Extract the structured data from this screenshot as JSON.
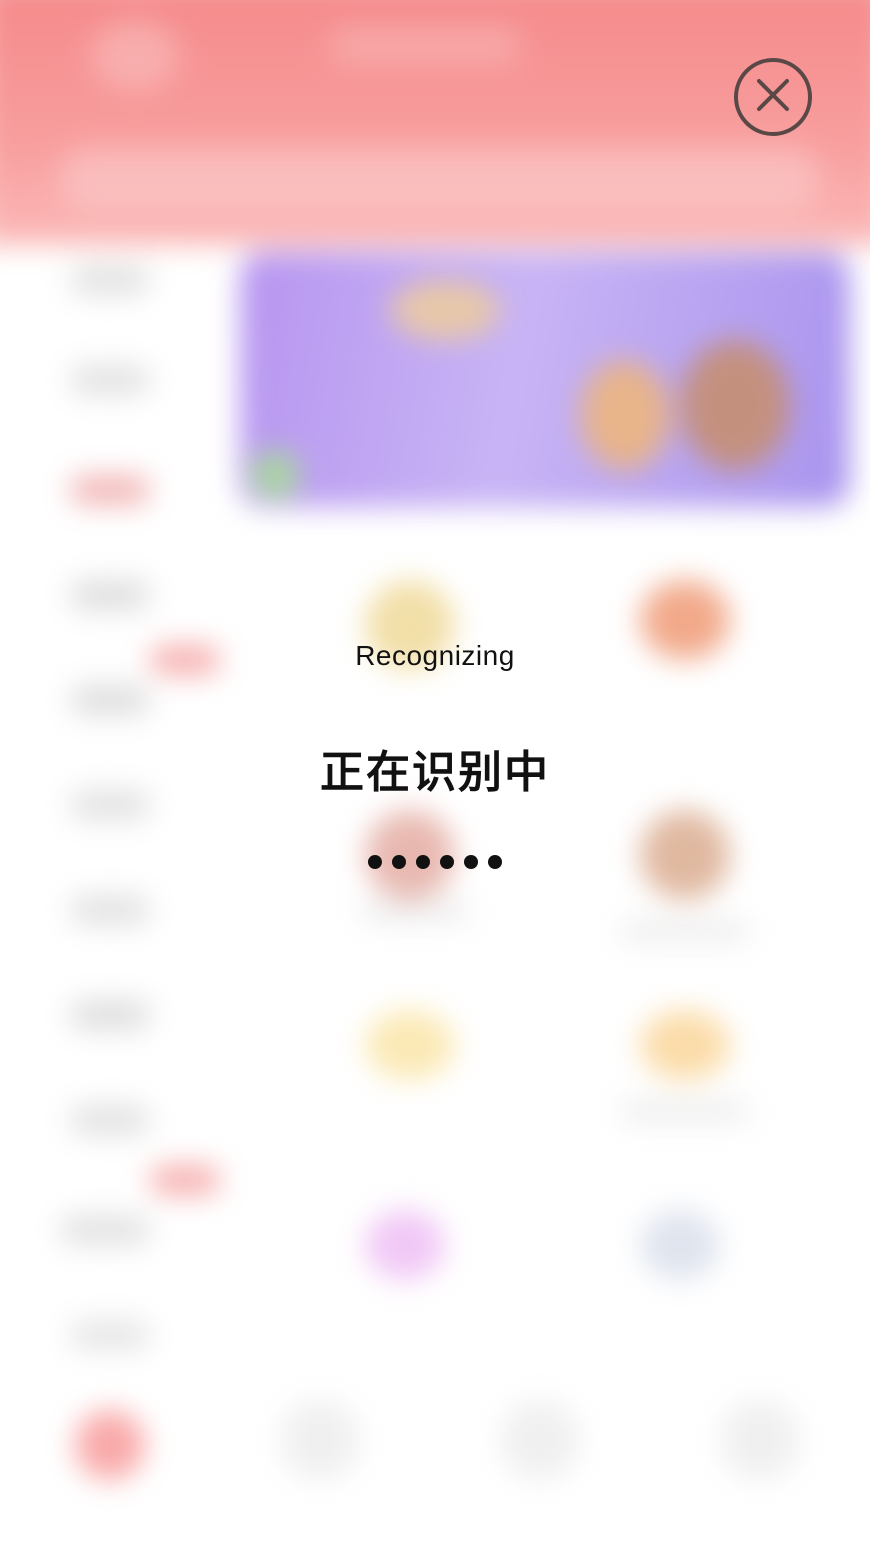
{
  "status": {
    "title_en": "Recognizing",
    "title_zh": "正在识别中",
    "dots": 6
  },
  "close": {
    "icon": "close-icon"
  },
  "colors": {
    "header": "#f5898a",
    "banner": "#b795f0",
    "text": "#111111",
    "close_ring": "#5a4847"
  }
}
